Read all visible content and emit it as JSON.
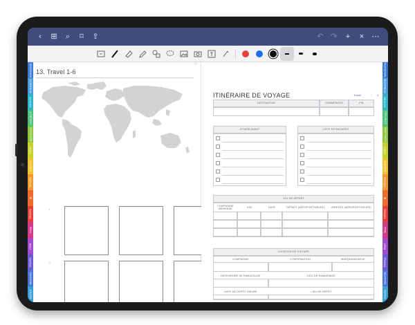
{
  "topbar": {
    "left_icons": [
      "chevron-left-icon",
      "grid-icon",
      "search-icon",
      "bookmark-icon",
      "share-icon"
    ],
    "right_icons": [
      "undo-icon",
      "redo-icon",
      "add-icon",
      "close-icon",
      "more-icon"
    ]
  },
  "toolbar": {
    "tools": [
      "lasso-icon",
      "pen-icon",
      "eraser-icon",
      "highlighter-icon",
      "shapes-icon",
      "lasso-select-icon",
      "image-icon",
      "camera-icon",
      "text-icon",
      "pointer-icon"
    ],
    "colors": [
      "#e9413a",
      "#1e6ff0",
      "#111111"
    ],
    "selected_color": "#111111"
  },
  "left_tabs": [
    {
      "label": "PERSONAL",
      "color": "#3a7bd5"
    },
    {
      "label": "BUSINESS",
      "color": "#4a9be0"
    },
    {
      "label": "HEALTH",
      "color": "#2bb6c9"
    },
    {
      "label": "PROJECT",
      "color": "#4cc27a"
    },
    {
      "label": "MEETINGS",
      "color": "#8cc63f"
    },
    {
      "label": "TODO",
      "color": "#c9d12f"
    },
    {
      "label": "EVENTS",
      "color": "#f2c12e"
    },
    {
      "label": "TRAVEL",
      "color": "#f29a2e"
    },
    {
      "label": "IB",
      "color": "#f06a2e"
    },
    {
      "label": "TRAVEL",
      "color": "#e9413a"
    },
    {
      "label": "TIME",
      "color": "#d43a8a"
    },
    {
      "label": "CRM",
      "color": "#a04bd1"
    },
    {
      "label": "TRAVEL",
      "color": "#6c5ad6"
    },
    {
      "label": "READING",
      "color": "#4a74d8"
    },
    {
      "label": "NOTES",
      "color": "#3aa0d8"
    }
  ],
  "right_tabs": [
    {
      "label": "PERSONAL",
      "color": "#3a7bd5"
    },
    {
      "label": "BUSINESS",
      "color": "#4a9be0"
    },
    {
      "label": "HEALTH",
      "color": "#2bb6c9"
    },
    {
      "label": "PROJECT",
      "color": "#4cc27a"
    },
    {
      "label": "MEETINGS",
      "color": "#8cc63f"
    },
    {
      "label": "TODO",
      "color": "#c9d12f"
    },
    {
      "label": "EVENTS",
      "color": "#f2c12e"
    },
    {
      "label": "TRAVEL",
      "color": "#f29a2e"
    },
    {
      "label": "IB",
      "color": "#f06a2e"
    },
    {
      "label": "TRAVEL",
      "color": "#e9413a"
    },
    {
      "label": "TIME",
      "color": "#d43a8a"
    },
    {
      "label": "CRM",
      "color": "#a04bd1"
    },
    {
      "label": "TRAVEL",
      "color": "#6c5ad6"
    },
    {
      "label": "READING",
      "color": "#4a74d8"
    },
    {
      "label": "NOTES",
      "color": "#3aa0d8"
    }
  ],
  "left_page": {
    "title": "13. Travel 1-6",
    "box_numbers": [
      "1",
      "2",
      "3",
      "4",
      "5",
      "6"
    ]
  },
  "right_page": {
    "title": "ITINÉRAIRE DE VOYAGE",
    "nav_label": "Travel",
    "page_number": "1",
    "destination_table": {
      "headers": [
        "DESTINATION",
        "COMMENCER",
        "FIN"
      ]
    },
    "todo_title": "A FAIRE AVANT",
    "packing_title": "LISTE DE BAGAGES",
    "flight": {
      "title": "VOL DE DÉPART",
      "headers": [
        "COMPAGNIE AÉRIENNE",
        "VOL",
        "DATE",
        "DÉPART (AÉROPORT/HEURE)",
        "ARRIVÉE (AÉROPORT/HEURE)"
      ]
    },
    "car": {
      "title": "LOCATION DE VOITURE",
      "row1": [
        "COMPAGNIE",
        "CONFIRMATION",
        "MARQUE/MODÈLE"
      ],
      "row2": [
        "DATE/HEURE DE RAMASSAGE",
        "LIEU DE RAMASSAGE"
      ],
      "row3": [
        "DATE DE DÉPÔT /HEURE",
        "LIEU DE DÉPÔT"
      ]
    }
  }
}
